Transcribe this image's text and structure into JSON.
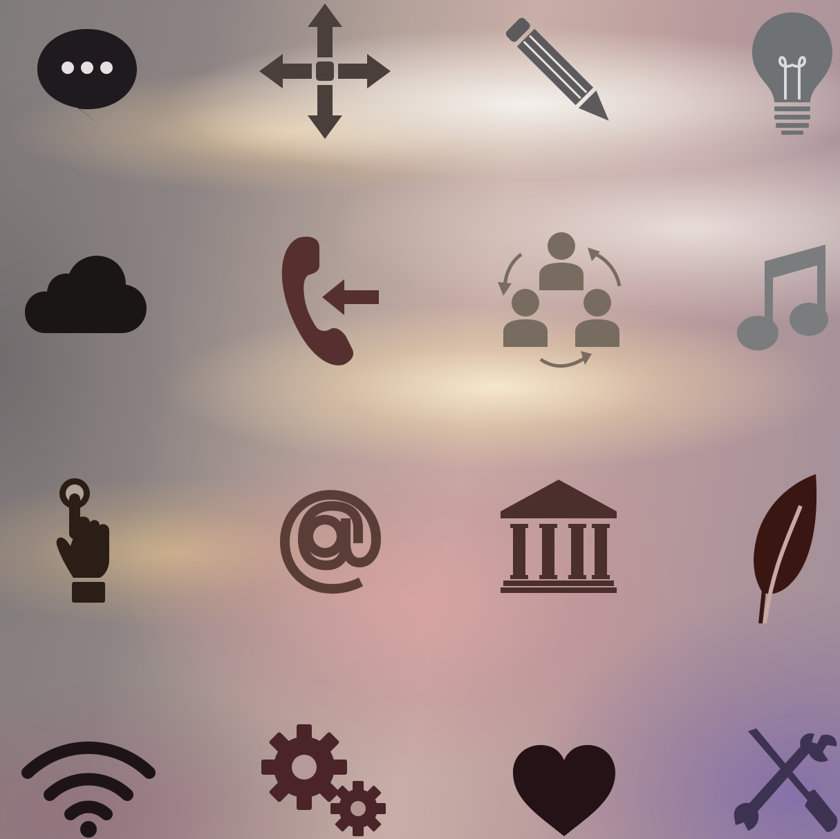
{
  "icons": [
    {
      "name": "speech-bubble-icon",
      "color": "#1e1a1d"
    },
    {
      "name": "move-arrows-icon",
      "color": "#4a3f3a"
    },
    {
      "name": "pencil-icon",
      "color": "#5c5a5c"
    },
    {
      "name": "lightbulb-icon",
      "color": "#6e7274"
    },
    {
      "name": "cloud-icon",
      "color": "#1a1616"
    },
    {
      "name": "incoming-call-icon",
      "color": "#55302e"
    },
    {
      "name": "team-cycle-icon",
      "color": "#786c60"
    },
    {
      "name": "music-note-icon",
      "color": "#7a7c7d"
    },
    {
      "name": "touch-hand-icon",
      "color": "#2a1e16"
    },
    {
      "name": "at-sign-icon",
      "color": "#5a3d36"
    },
    {
      "name": "bank-building-icon",
      "color": "#4a2f2d"
    },
    {
      "name": "leaf-icon",
      "color": "#3a1612"
    },
    {
      "name": "wifi-icon",
      "color": "#1e1418"
    },
    {
      "name": "gears-icon",
      "color": "#4a2428"
    },
    {
      "name": "heart-icon",
      "color": "#241216"
    },
    {
      "name": "tools-icon",
      "color": "#3e3252"
    }
  ]
}
